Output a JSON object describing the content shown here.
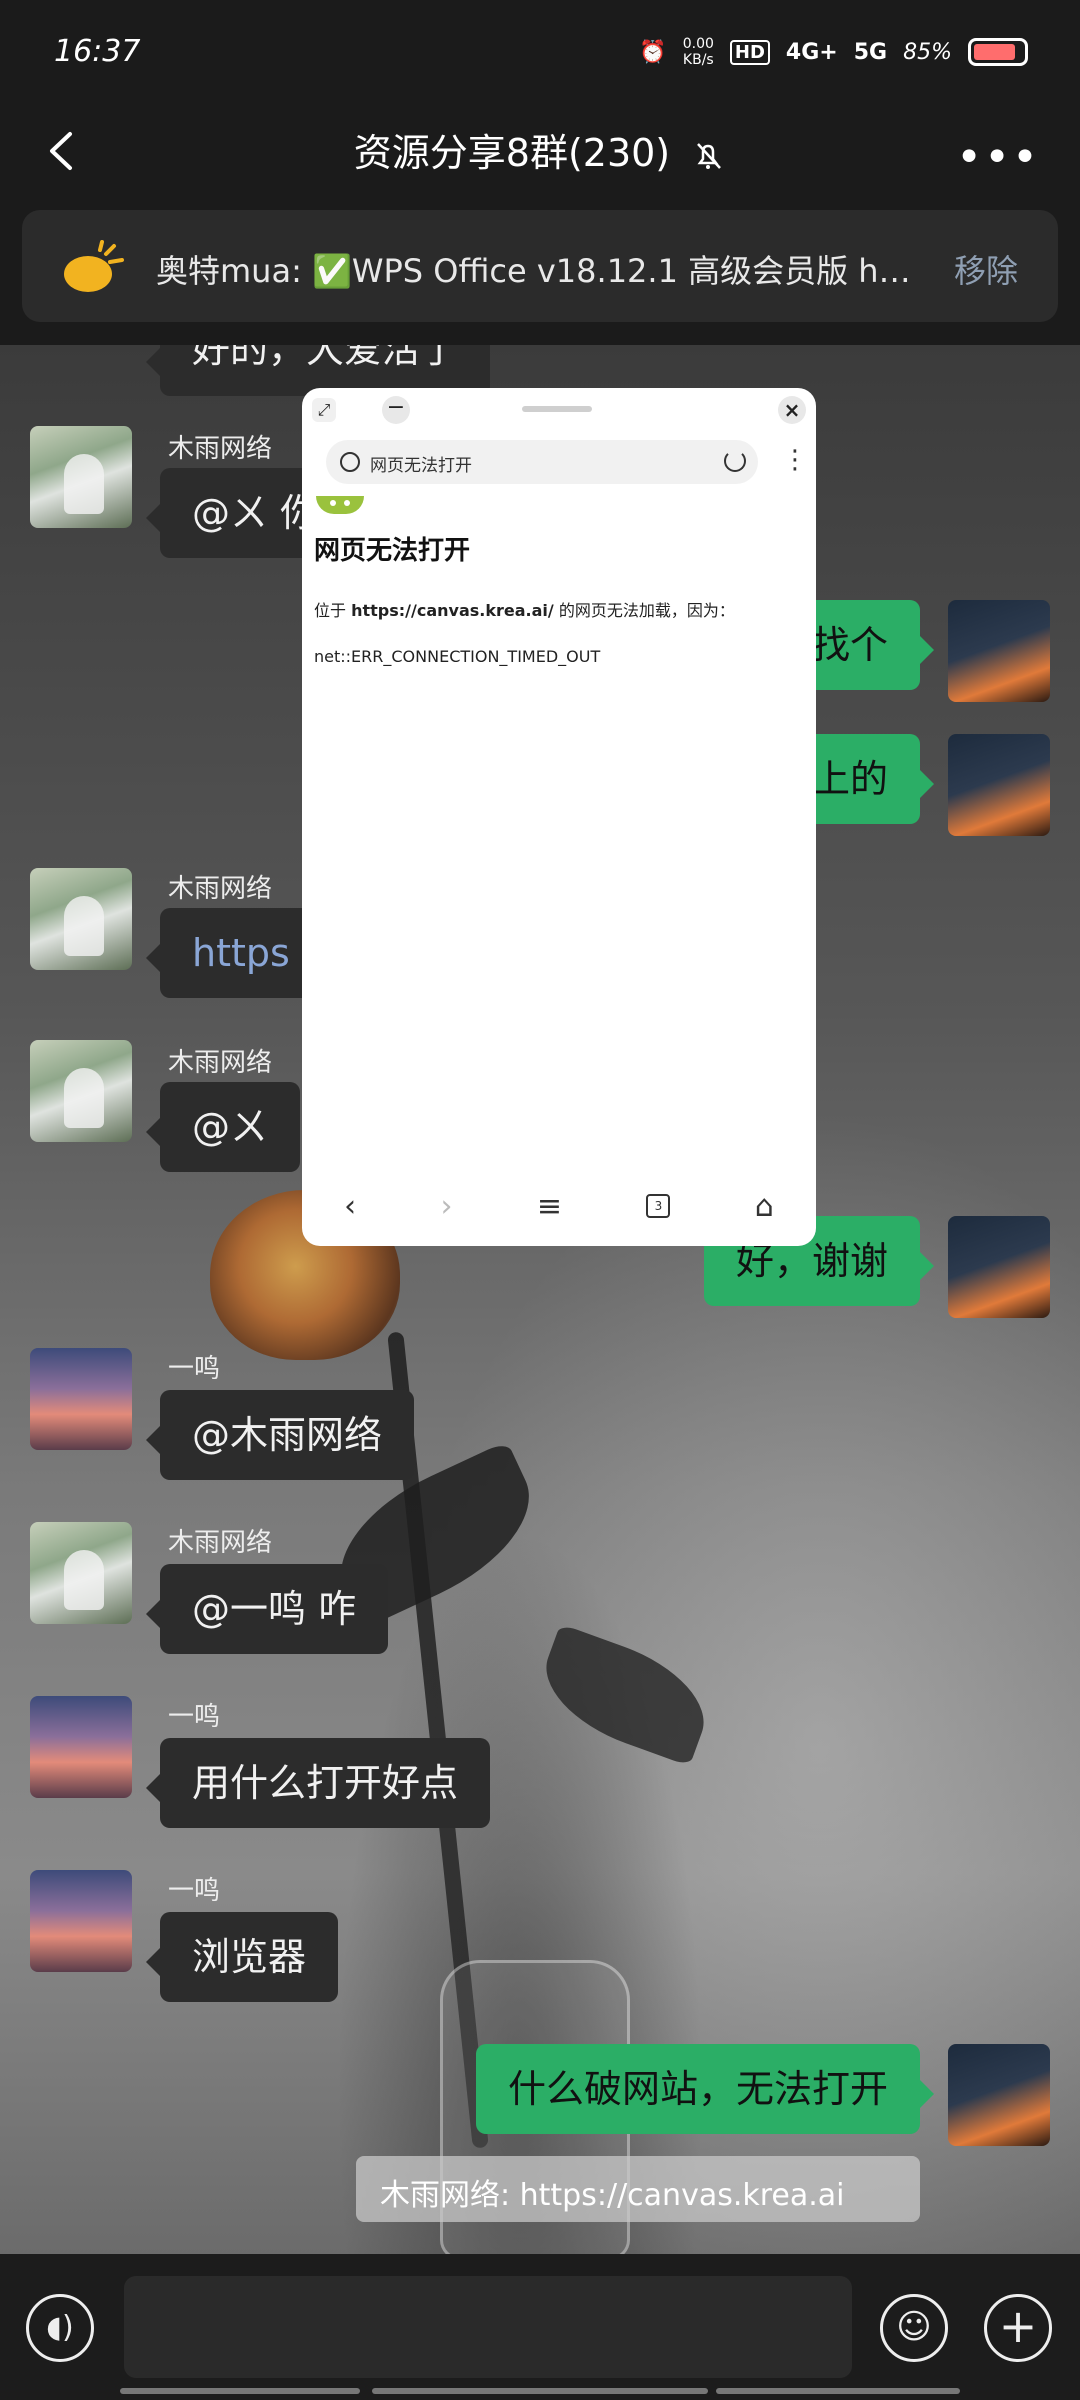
{
  "status_bar": {
    "time": "16:37",
    "net_speed_value": "0.00",
    "net_speed_unit": "KB/s",
    "hd_label": "HD",
    "lte_label": "4G+",
    "fiveg_label": "5G",
    "battery_percent": "85%",
    "battery_level": 0.85
  },
  "header": {
    "title": "资源分享8群(230)",
    "back_icon": "back-chevron-icon",
    "mute_icon": "bell-off-icon",
    "more_icon": "more-icon"
  },
  "pinned": {
    "text": "奥特mua: ✅WPS Office v18.12.1 高级会员版 h…",
    "remove_label": "移除",
    "icon": "megaphone-icon"
  },
  "messages": [
    {
      "side": "left",
      "sender": "",
      "text": "好的，大爱活了",
      "partial": true
    },
    {
      "side": "left",
      "sender": "木雨网络",
      "text": "@ㄨ 你"
    },
    {
      "side": "right",
      "text": "找个"
    },
    {
      "side": "right",
      "text": "上的"
    },
    {
      "side": "left",
      "sender": "木雨网络",
      "text": "https"
    },
    {
      "side": "left",
      "sender": "木雨网络",
      "text": "@ㄨ"
    },
    {
      "side": "right",
      "text": "好，谢谢"
    },
    {
      "side": "left",
      "sender": "一鸣",
      "text": "@木雨网络"
    },
    {
      "side": "left",
      "sender": "木雨网络",
      "text": "@一鸣 咋"
    },
    {
      "side": "left",
      "sender": "一鸣",
      "text": "用什么打开好点"
    },
    {
      "side": "left",
      "sender": "一鸣",
      "text": "浏览器"
    },
    {
      "side": "right",
      "text": "什么破网站，无法打开"
    }
  ],
  "quote": {
    "text": "木雨网络: https://canvas.krea.ai"
  },
  "floating_browser": {
    "url_text": "网页无法打开",
    "error_title": "网页无法打开",
    "error_prefix": "位于 ",
    "error_url": "https://canvas.krea.ai/",
    "error_suffix": " 的网页无法加载，因为：",
    "error_code": "net::ERR_CONNECTION_TIMED_OUT",
    "tab_count": "3"
  },
  "input_bar": {
    "input_value": "",
    "voice_icon": "voice-icon",
    "emoji_icon": "emoji-icon",
    "plus_icon": "plus-icon"
  }
}
